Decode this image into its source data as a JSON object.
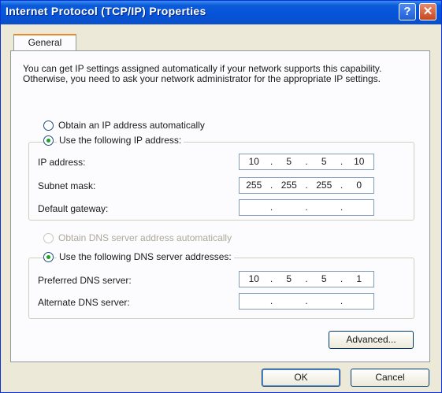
{
  "window": {
    "title": "Internet Protocol (TCP/IP) Properties",
    "help_glyph": "?",
    "close_glyph": "✕"
  },
  "tabs": [
    {
      "label": "General"
    }
  ],
  "description": "You can get IP settings assigned automatically if your network supports this capability. Otherwise, you need to ask your network administrator for the appropriate IP settings.",
  "ip": {
    "auto_label": "Obtain an IP address automatically",
    "manual_label": "Use the following IP address:",
    "selected": "manual",
    "fields": [
      {
        "label": "IP address:",
        "octets": [
          "10",
          "5",
          "5",
          "10"
        ]
      },
      {
        "label": "Subnet mask:",
        "octets": [
          "255",
          "255",
          "255",
          "0"
        ]
      },
      {
        "label": "Default gateway:",
        "octets": [
          "",
          "",
          "",
          ""
        ]
      }
    ]
  },
  "dns": {
    "auto_label": "Obtain DNS server address automatically",
    "manual_label": "Use the following DNS server addresses:",
    "selected": "manual",
    "fields": [
      {
        "label": "Preferred DNS server:",
        "octets": [
          "10",
          "5",
          "5",
          "1"
        ]
      },
      {
        "label": "Alternate DNS server:",
        "octets": [
          "",
          "",
          "",
          ""
        ]
      }
    ]
  },
  "buttons": {
    "advanced": "Advanced...",
    "ok": "OK",
    "cancel": "Cancel"
  }
}
